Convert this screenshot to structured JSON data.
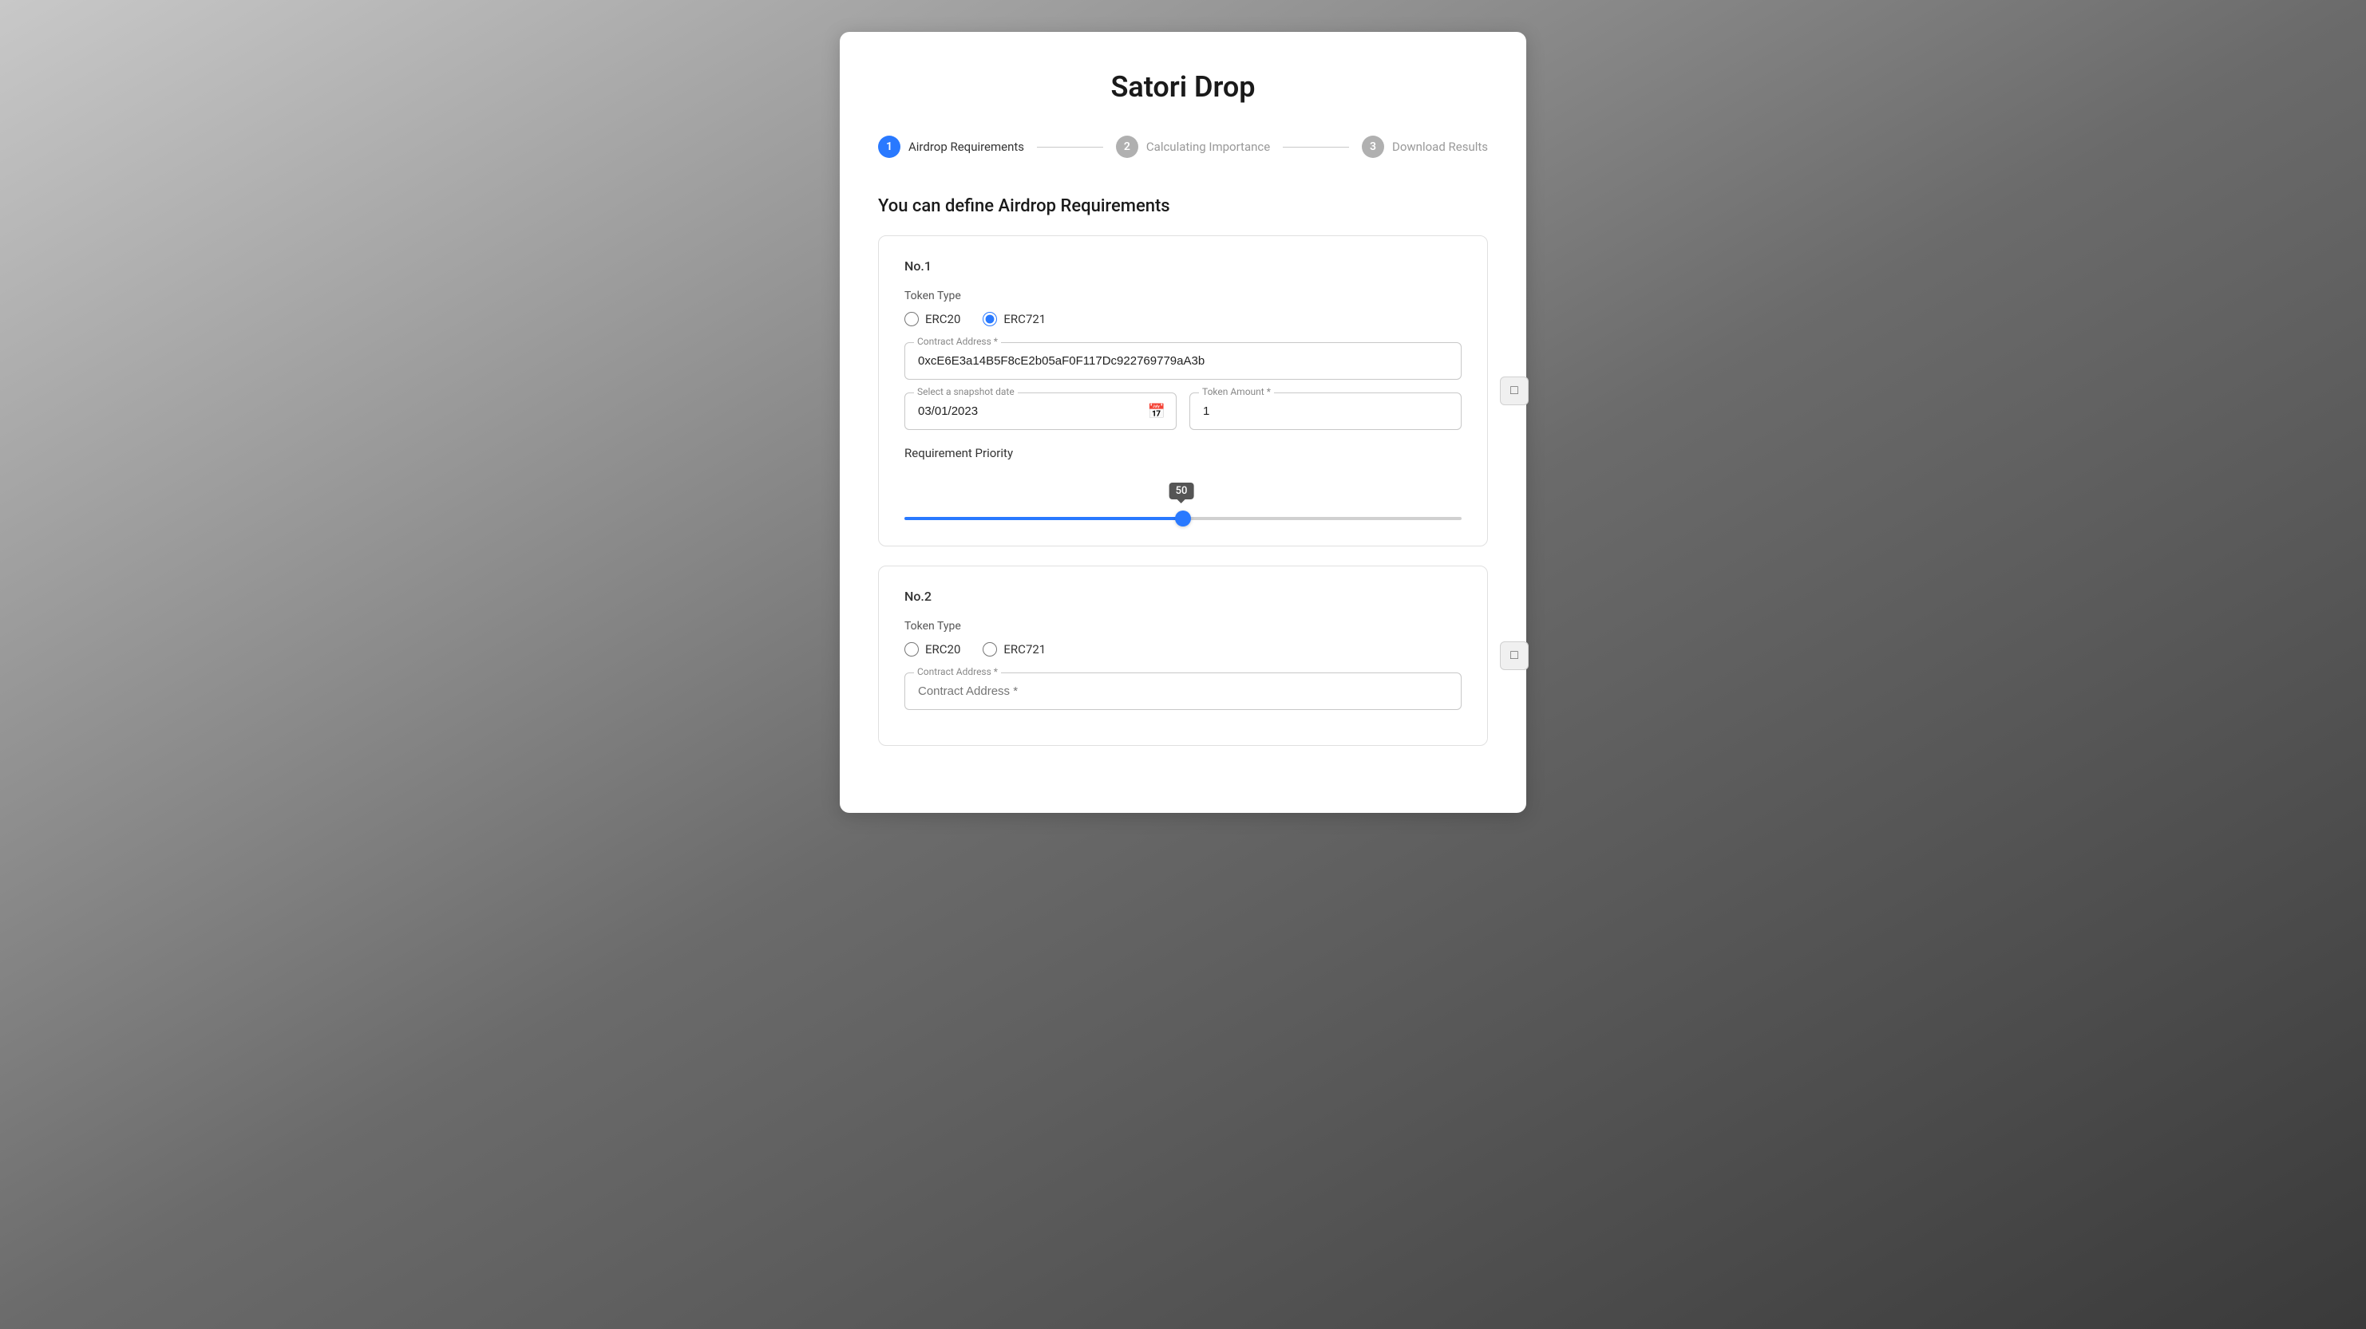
{
  "page": {
    "title": "Satori Drop"
  },
  "stepper": {
    "steps": [
      {
        "id": "step-1",
        "number": "1",
        "label": "Airdrop Requirements",
        "active": true
      },
      {
        "id": "step-2",
        "number": "2",
        "label": "Calculating Importance",
        "active": false
      },
      {
        "id": "step-3",
        "number": "3",
        "label": "Download Results",
        "active": false
      }
    ]
  },
  "section": {
    "heading": "You can define Airdrop Requirements"
  },
  "card1": {
    "number": "No.1",
    "token_type_label": "Token Type",
    "erc20_label": "ERC20",
    "erc721_label": "ERC721",
    "erc721_selected": true,
    "contract_address_label": "Contract Address *",
    "contract_address_value": "0xcE6E3a14B5F8cE2b05aF0F117Dc922769779aA3b",
    "snapshot_date_label": "Select a snapshot date",
    "snapshot_date_value": "03/01/2023",
    "token_amount_label": "Token Amount *",
    "token_amount_value": "1",
    "requirement_priority_label": "Requirement Priority",
    "slider_value": 50,
    "slider_tooltip": "50"
  },
  "card2": {
    "number": "No.2",
    "token_type_label": "Token Type",
    "erc20_label": "ERC20",
    "erc721_label": "ERC721",
    "erc721_selected": false,
    "contract_address_label": "Contract Address *",
    "contract_address_value": ""
  },
  "icons": {
    "calendar": "📅",
    "delete": "⊟"
  }
}
